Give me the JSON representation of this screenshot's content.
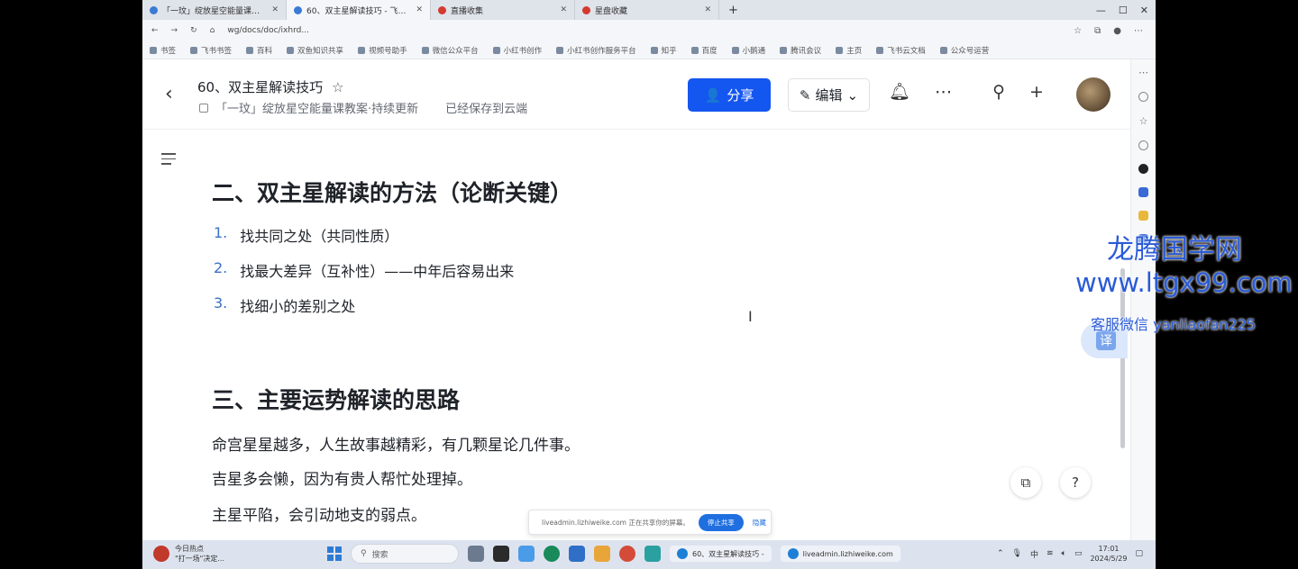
{
  "browser": {
    "tabs": [
      {
        "label": "「一玟」绽放星空能量课教案·持续更新",
        "active": false
      },
      {
        "label": "60、双主星解读技巧 - 飞书云文档",
        "active": true
      },
      {
        "label": "直播收集",
        "active": false
      },
      {
        "label": "星盘收藏",
        "active": false
      }
    ],
    "url": "wg/docs/doc/ixhrd...",
    "bookmarks": [
      "书签",
      "飞书书签",
      "百科",
      "双鱼知识共享",
      "视频号助手",
      "微信公众平台",
      "小红书创作",
      "小红书创作服务平台",
      "知乎",
      "百度",
      "小鹅通",
      "腾讯会议",
      "主页",
      "飞书云文档",
      "公众号运营"
    ]
  },
  "doc": {
    "title": "60、双主星解读技巧",
    "breadcrumb": "「一玟」绽放星空能量课教案·持续更新",
    "saved_status": "已经保存到云端",
    "share_label": "分享",
    "edit_label": "编辑"
  },
  "content": {
    "h2_a": "二、双主星解读的方法（论断关键）",
    "list": [
      {
        "num": "1.",
        "text": "找共同之处（共同性质）"
      },
      {
        "num": "2.",
        "text": "找最大差异（互补性）——中年后容易出来"
      },
      {
        "num": "3.",
        "text": "找细小的差别之处"
      }
    ],
    "h2_b": "三、主要运势解读的思路",
    "paragraphs": [
      "命宫星星越多，人生故事越精彩，有几颗星论几件事。",
      "吉星多会懒，因为有贵人帮忙处理掉。",
      "主星平陷，会引动地支的弱点。"
    ]
  },
  "ui": {
    "translate_label": "译",
    "notice_text": "liveadmin.lizhiweike.com 正在共享你的屏幕。",
    "notice_stop": "停止共享",
    "notice_hide": "隐藏"
  },
  "taskbar": {
    "news_title": "今日热点",
    "news_sub": "\"打一场\"决定...",
    "search_placeholder": "搜索",
    "item1": "60、双主星解读技巧 -",
    "item2": "liveadmin.lizhiweike.com",
    "ime": "中",
    "time": "17:01",
    "date": "2024/5/29"
  },
  "watermark": {
    "line1": "龙腾国学网",
    "line2": "www.ltgx99.com",
    "line3": "客服微信 yanliaofan225"
  },
  "colors": {
    "accent": "#1456f0",
    "list_number": "#3a70c8"
  }
}
